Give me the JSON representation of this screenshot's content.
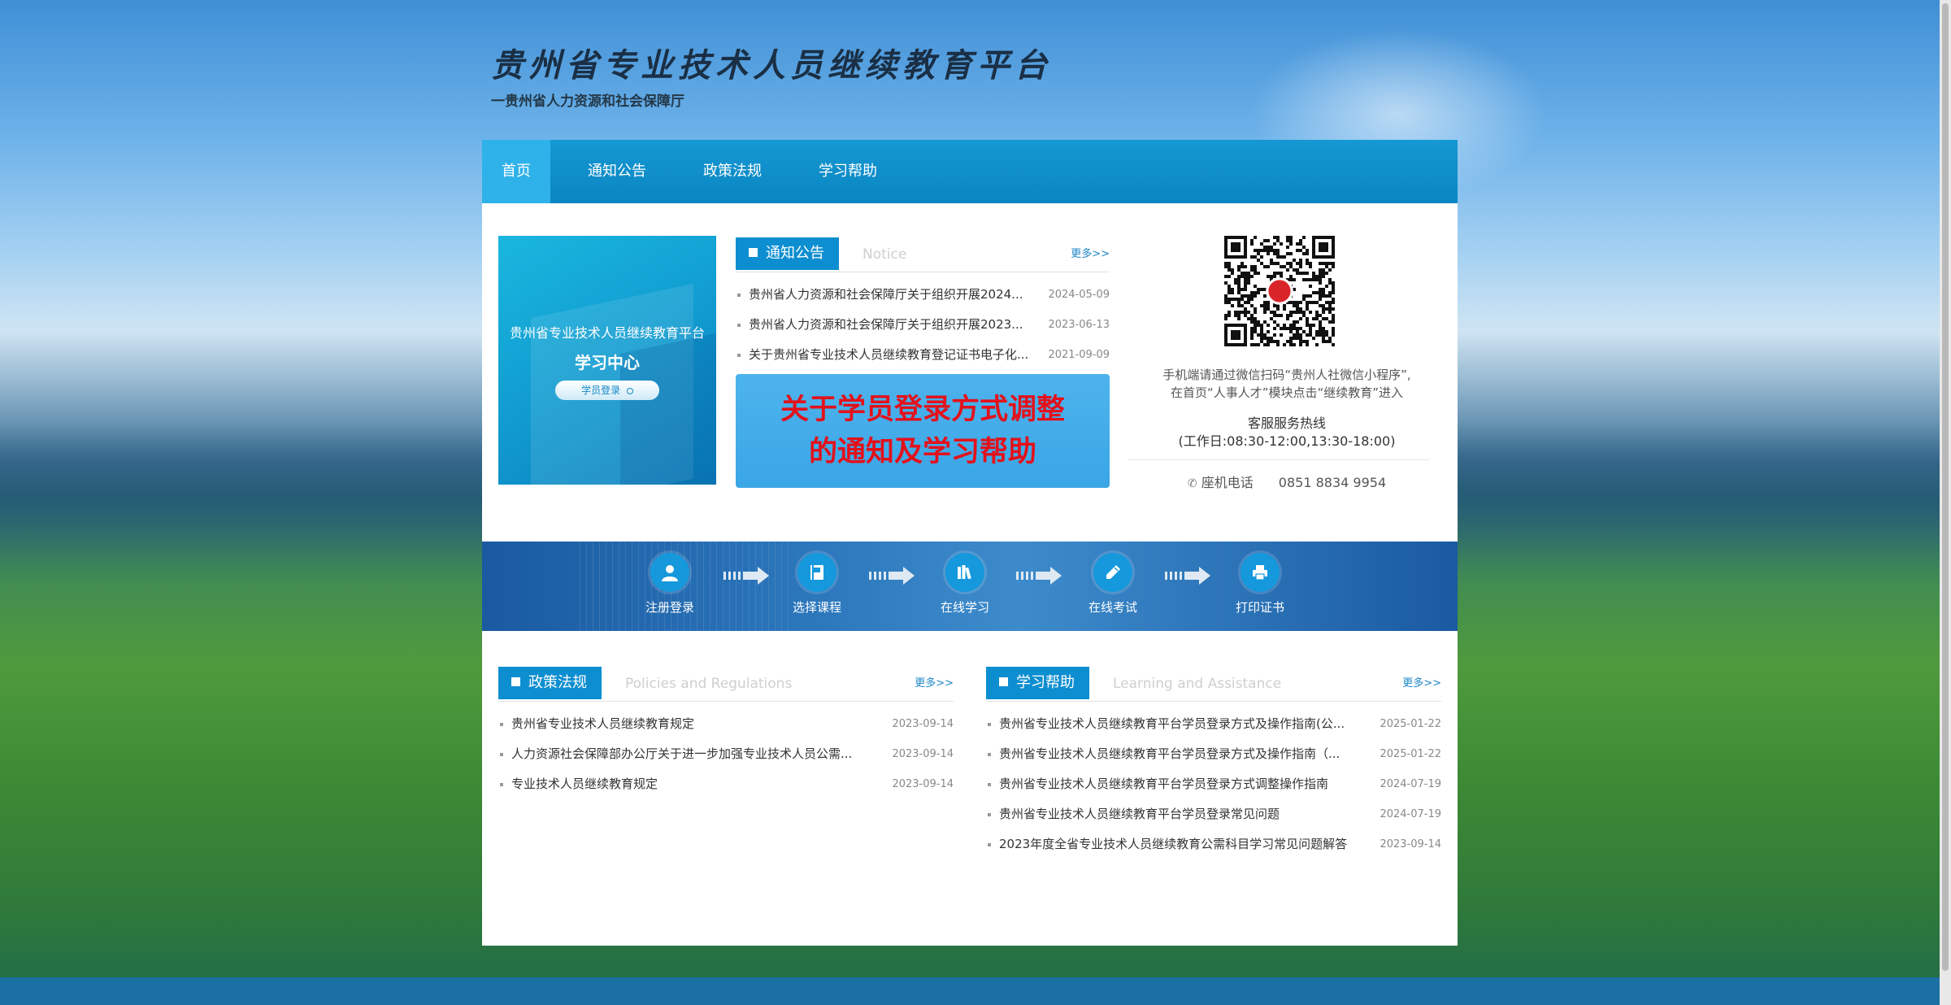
{
  "header": {
    "title": "贵州省专业技术人员继续教育平台",
    "subtitle": "一贵州省人力资源和社会保障厅"
  },
  "nav": {
    "items": [
      {
        "label": "首页",
        "active": true
      },
      {
        "label": "通知公告",
        "active": false
      },
      {
        "label": "政策法规",
        "active": false
      },
      {
        "label": "学习帮助",
        "active": false
      }
    ]
  },
  "learning_center": {
    "platform": "贵州省专业技术人员继续教育平台",
    "title": "学习中心",
    "button": "学员登录"
  },
  "notices": {
    "title": "通知公告",
    "title_en": "Notice",
    "more": "更多>>",
    "items": [
      {
        "title": "贵州省人力资源和社会保障厅关于组织开展2024...",
        "date": "2024-05-09"
      },
      {
        "title": "贵州省人力资源和社会保障厅关于组织开展2023...",
        "date": "2023-06-13"
      },
      {
        "title": "关于贵州省专业技术人员继续教育登记证书电子化...",
        "date": "2021-09-09"
      }
    ],
    "banner_line1": "关于学员登录方式调整",
    "banner_line2": "的通知及学习帮助"
  },
  "contact": {
    "qr_text_1": "手机端请通过微信扫码“贵州人社微信小程序”,",
    "qr_text_2": "在首页“人事人才”模块点击“继续教育”进入",
    "hotline_title": "客服服务热线",
    "hotline_hours": "(工作日:08:30-12:00,13:30-18:00)",
    "phone_label": "座机电话",
    "phone_number": "0851 8834 9954"
  },
  "process": {
    "steps": [
      {
        "label": "注册登录",
        "icon": "user-icon"
      },
      {
        "label": "选择课程",
        "icon": "book-icon"
      },
      {
        "label": "在线学习",
        "icon": "books-icon"
      },
      {
        "label": "在线考试",
        "icon": "pencil-icon"
      },
      {
        "label": "打印证书",
        "icon": "printer-icon"
      }
    ]
  },
  "policies": {
    "title": "政策法规",
    "title_en": "Policies and Regulations",
    "more": "更多>>",
    "items": [
      {
        "title": "贵州省专业技术人员继续教育规定",
        "date": "2023-09-14"
      },
      {
        "title": "人力资源社会保障部办公厅关于进一步加强专业技术人员公需...",
        "date": "2023-09-14"
      },
      {
        "title": "专业技术人员继续教育规定",
        "date": "2023-09-14"
      }
    ]
  },
  "help": {
    "title": "学习帮助",
    "title_en": "Learning and Assistance",
    "more": "更多>>",
    "items": [
      {
        "title": "贵州省专业技术人员继续教育平台学员登录方式及操作指南(公...",
        "date": "2025-01-22"
      },
      {
        "title": "贵州省专业技术人员继续教育平台学员登录方式及操作指南（...",
        "date": "2025-01-22"
      },
      {
        "title": "贵州省专业技术人员继续教育平台学员登录方式调整操作指南",
        "date": "2024-07-19"
      },
      {
        "title": "贵州省专业技术人员继续教育平台学员登录常见问题",
        "date": "2024-07-19"
      },
      {
        "title": "2023年度全省专业技术人员继续教育公需科目学习常见问题解答",
        "date": "2023-09-14"
      }
    ]
  },
  "colors": {
    "nav": "#0a86c2",
    "nav_active": "#2fb2ea",
    "section_tab": "#0d8ed0",
    "banner_text": "#e3111b"
  }
}
